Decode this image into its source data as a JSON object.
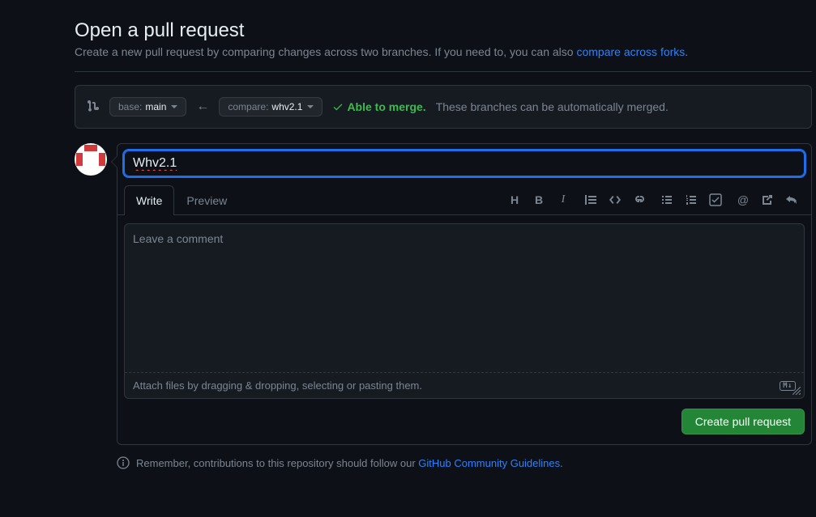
{
  "header": {
    "title": "Open a pull request",
    "subtitle_prefix": "Create a new pull request by comparing changes across two branches. If you need to, you can also ",
    "subtitle_link": "compare across forks",
    "subtitle_suffix": "."
  },
  "branches": {
    "base_label": "base: ",
    "base_value": "main",
    "compare_label": "compare: ",
    "compare_value": "whv2.1",
    "merge_status": "Able to merge.",
    "merge_message": " These branches can be automatically merged."
  },
  "form": {
    "title_value": "Whv2.1",
    "tabs": {
      "write": "Write",
      "preview": "Preview"
    },
    "comment_placeholder": "Leave a comment",
    "attach_text": "Attach files by dragging & dropping, selecting or pasting them.",
    "markdown_badge": "M↓",
    "submit_label": "Create pull request"
  },
  "footer": {
    "prefix": "Remember, contributions to this repository should follow our ",
    "link": "GitHub Community Guidelines",
    "suffix": "."
  }
}
